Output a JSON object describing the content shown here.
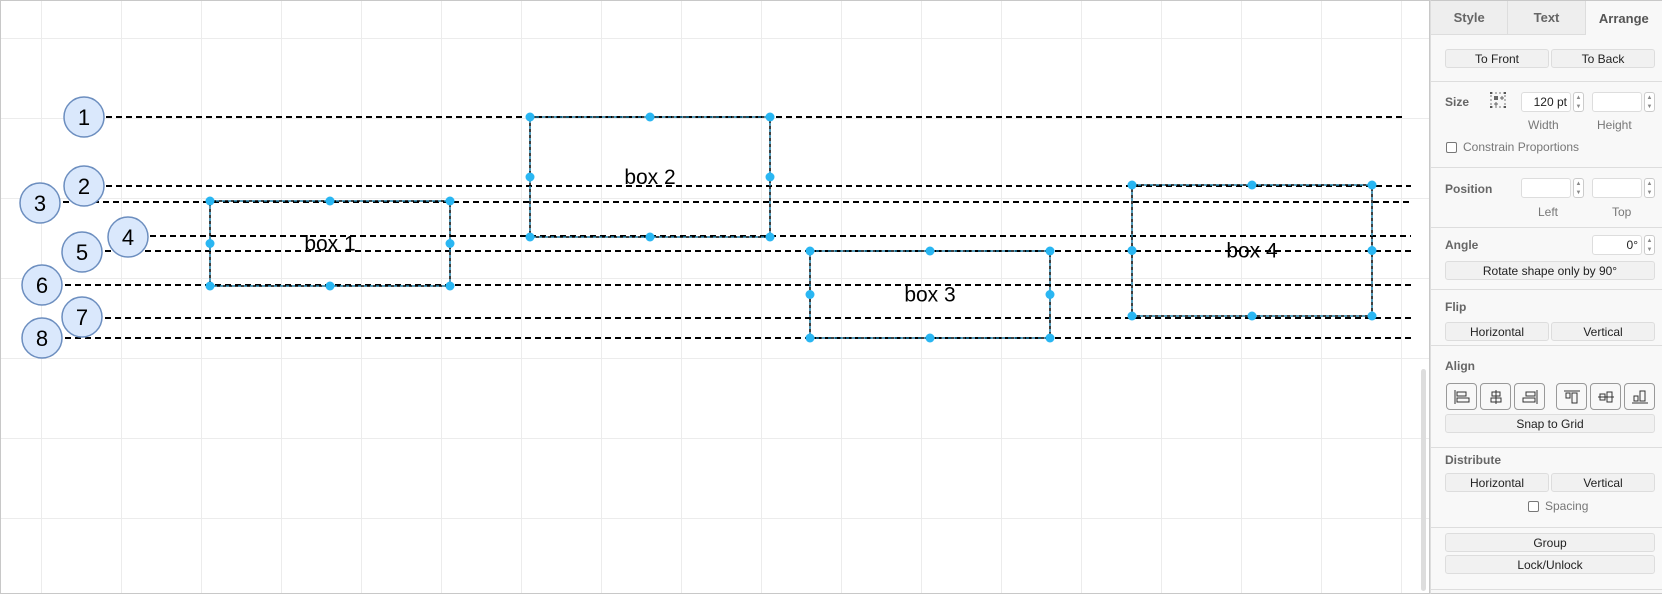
{
  "canvas": {
    "guides": [
      {
        "id": 1,
        "label": "1"
      },
      {
        "id": 2,
        "label": "2"
      },
      {
        "id": 3,
        "label": "3"
      },
      {
        "id": 4,
        "label": "4"
      },
      {
        "id": 5,
        "label": "5"
      },
      {
        "id": 6,
        "label": "6"
      },
      {
        "id": 7,
        "label": "7"
      },
      {
        "id": 8,
        "label": "8"
      }
    ],
    "shapes": [
      {
        "label": "box 1",
        "selected": true
      },
      {
        "label": "box 2",
        "selected": true
      },
      {
        "label": "box 3",
        "selected": true
      },
      {
        "label": "box 4",
        "selected": true
      }
    ],
    "colors": {
      "handle": "#29b6f2",
      "circle_fill": "#dae8fc",
      "circle_stroke": "#6c8ebf",
      "guide": "#000000"
    }
  },
  "panel": {
    "tabs": [
      {
        "label": "Style",
        "active": false
      },
      {
        "label": "Text",
        "active": false
      },
      {
        "label": "Arrange",
        "active": true
      }
    ],
    "order": {
      "to_front": "To Front",
      "to_back": "To Back"
    },
    "size": {
      "label": "Size",
      "width_value": "120 pt",
      "height_value": "",
      "width_label": "Width",
      "height_label": "Height",
      "constrain_label": "Constrain Proportions",
      "constrain_checked": false
    },
    "position": {
      "label": "Position",
      "left_value": "",
      "top_value": "",
      "left_label": "Left",
      "top_label": "Top"
    },
    "angle": {
      "label": "Angle",
      "value": "0°",
      "rotate_button": "Rotate shape only by 90°"
    },
    "flip": {
      "label": "Flip",
      "horizontal": "Horizontal",
      "vertical": "Vertical"
    },
    "align": {
      "label": "Align",
      "buttons": [
        "align-left",
        "align-center",
        "align-right",
        "align-top",
        "align-middle",
        "align-bottom"
      ],
      "snap_to_grid": "Snap to Grid"
    },
    "distribute": {
      "label": "Distribute",
      "horizontal": "Horizontal",
      "vertical": "Vertical",
      "spacing_label": "Spacing",
      "spacing_checked": false
    },
    "group": "Group",
    "lock_unlock": "Lock/Unlock"
  }
}
